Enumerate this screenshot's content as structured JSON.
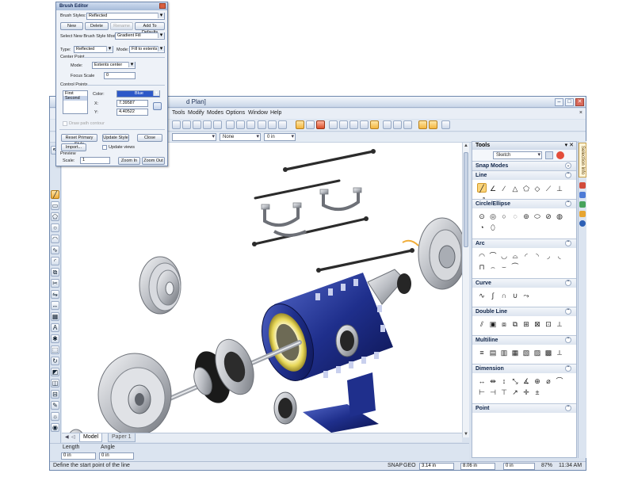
{
  "app": {
    "title_fragment": "d Plan]",
    "menus": [
      "Tools",
      "Modify",
      "Modes",
      "Options",
      "Window",
      "Help"
    ],
    "toolbar_combo_line": "None",
    "toolbar_combo_width": "0 in",
    "canvas_tabs": [
      "Model",
      "Paper 1"
    ],
    "input_bar": {
      "length_label": "Length",
      "length_value": "0 in",
      "angle_label": "Angle",
      "angle_value": "0 in"
    },
    "status": {
      "prompt": "Define the start point of the line",
      "snap": "SNAP",
      "geo": "GEO",
      "x": "3.14 in",
      "y": "8.06 in",
      "z": "0 in",
      "zoom": "87%",
      "time": "11:34 AM"
    }
  },
  "tools_panel": {
    "title": "Tools",
    "mode": "Sketch",
    "sections": [
      {
        "label": "Snap Modes",
        "icons": []
      },
      {
        "label": "Line",
        "icons": [
          "line-icon",
          "line-angle-icon",
          "line-parallel-icon",
          "triangle-icon",
          "polygon-icon",
          "rhombus-icon",
          "line-tangent-icon",
          "line-perp-icon",
          "line-extend-icon"
        ]
      },
      {
        "label": "Circle/Ellipse",
        "icons": [
          "circle-center-icon",
          "circle-concentric-icon",
          "circle-tangent-icon",
          "circle-3pt-icon",
          "circle-2pt-icon",
          "ellipse-icon",
          "ellipse-rotated-icon",
          "ellipse-arc-icon",
          "circle-inscribed-icon",
          "ellipse-tilted-icon"
        ]
      },
      {
        "label": "Arc",
        "icons": [
          "arc-center-icon",
          "arc-3pt-icon",
          "arc-tangent-icon",
          "arc-2pt-icon",
          "arc-radius-icon",
          "arc-angle-icon",
          "arc-sector-icon",
          "arc-chord-icon",
          "arc-ellipse-icon",
          "arc-flip-icon",
          "arc-join-icon",
          "arc-bridge-icon"
        ]
      },
      {
        "label": "Curve",
        "icons": [
          "curve-spline-icon",
          "curve-bezier-icon",
          "curve-sketch-icon",
          "curve-control-icon",
          "curve-link-icon"
        ]
      },
      {
        "label": "Double Line",
        "icons": [
          "dline-icon",
          "dline-rect-icon",
          "dline-poly-icon",
          "dline-join-icon",
          "dline-wall-icon",
          "dline-edit-icon",
          "dline-cap-icon",
          "dline-end-icon"
        ]
      },
      {
        "label": "Multiline",
        "icons": [
          "mline-icon",
          "mline-rect-icon",
          "mline-poly-icon",
          "mline-join-icon",
          "mline-wall-icon",
          "mline-edit-icon",
          "mline-cap-icon",
          "mline-end-icon"
        ]
      },
      {
        "label": "Dimension",
        "icons": [
          "dim-linear-icon",
          "dim-horizontal-icon",
          "dim-vertical-icon",
          "dim-aligned-icon",
          "dim-angular-icon",
          "dim-radial-icon",
          "dim-diameter-icon",
          "dim-arc-icon",
          "dim-ordinate-icon",
          "dim-baseline-icon",
          "dim-continuous-icon",
          "dim-leader-icon",
          "dim-center-icon",
          "dim-tolerance-icon"
        ]
      },
      {
        "label": "Point",
        "icons": []
      }
    ],
    "right_tab": "Selection Info"
  },
  "brush_editor": {
    "title": "Brush Editor",
    "brush_styles_label": "Brush Styles:",
    "brush_styles_value": "Reflected",
    "new_label": "New",
    "delete_label": "Delete",
    "rename_label": "Rename",
    "add_defaults_label": "Add To Defaults",
    "select_mode_label": "Select New Brush Style Mode:",
    "select_mode_value": "Gradient Fill",
    "type_label": "Type:",
    "type_value": "Reflected",
    "mode_label": "Mode:",
    "mode_value": "Fill to extents",
    "center_point_label": "Center Point",
    "center_mode_label": "Mode:",
    "center_mode_value": "Extents center",
    "focus_scale_label": "Focus Scale",
    "focus_scale_value": "0",
    "control_points_label": "Control Points",
    "points": [
      "First",
      "Second"
    ],
    "color_label": "Color:",
    "color_value": "Blue",
    "x_label": "X:",
    "x_value": "7.39587",
    "y_label": "Y:",
    "y_value": "4.40522",
    "draw_path_label": "Draw path contour",
    "reset_label": "Reset Primary Style",
    "update_style_label": "Update Style",
    "close_label": "Close",
    "import_label": "Import...",
    "update_views_label": "Update views",
    "preview_label": "Preview",
    "scale_label": "Scale:",
    "scale_value": "1",
    "zoom_in_label": "Zoom In",
    "zoom_out_label": "Zoom Out"
  },
  "colors": {
    "motor_blue": "#1f2f8c",
    "coil_gold": "#e8d85a",
    "steel": "#b9bcc2",
    "accent_orange": "#f0ad3a",
    "selected_blue": "#2d58c8"
  }
}
